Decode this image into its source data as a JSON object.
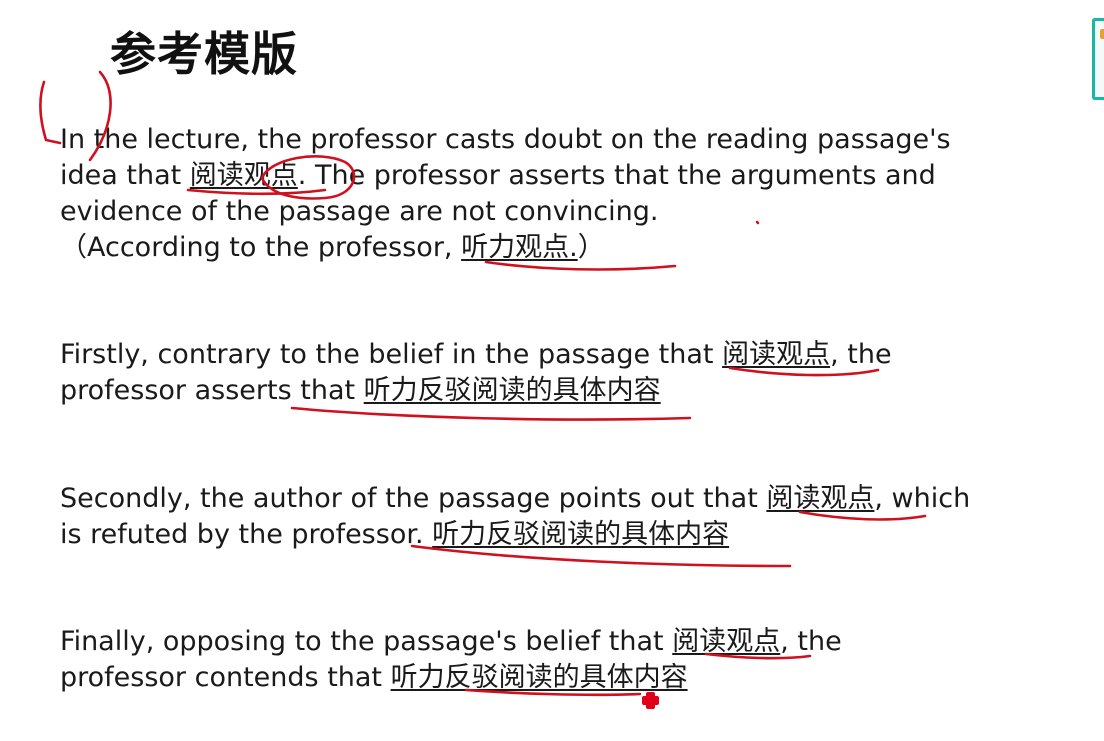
{
  "slide": {
    "title": "参考模版",
    "paragraphs": [
      {
        "lines": [
          [
            {
              "text": "In the lecture, the professor casts doubt on the reading passage's"
            }
          ],
          [
            {
              "text": "idea that "
            },
            {
              "text": "阅读观点",
              "underline": true
            },
            {
              "text": ". The professor asserts that the arguments and"
            }
          ],
          [
            {
              "text": "evidence of the passage are not convincing."
            }
          ],
          [
            {
              "text": "（According to the professor, "
            },
            {
              "text": "听力观点.",
              "underline": true
            },
            {
              "text": "）"
            }
          ]
        ]
      },
      {
        "lines": [
          [
            {
              "text": "Firstly, contrary to the belief in the passage that "
            },
            {
              "text": "阅读观点",
              "underline": true
            },
            {
              "text": ", the"
            }
          ],
          [
            {
              "text": "professor asserts that "
            },
            {
              "text": "听力反驳阅读的具体内容",
              "underline": true
            }
          ]
        ]
      },
      {
        "lines": [
          [
            {
              "text": "Secondly, the author of the passage points out that "
            },
            {
              "text": "阅读观点",
              "underline": true
            },
            {
              "text": ", which"
            }
          ],
          [
            {
              "text": "is refuted by the professor. "
            },
            {
              "text": "听力反驳阅读的具体内容",
              "underline": true
            }
          ]
        ]
      },
      {
        "lines": [
          [
            {
              "text": "Finally, opposing to the passage's belief that "
            },
            {
              "text": "阅读观点",
              "underline": true
            },
            {
              "text": ", the"
            }
          ],
          [
            {
              "text": "professor contends that "
            },
            {
              "text": "听力反驳阅读的具体内容",
              "underline": true
            }
          ]
        ]
      }
    ]
  },
  "annotations": {
    "ink_color": "#d0101e",
    "laser_color": "#e0001a"
  },
  "overlay": {
    "edge_widget_color": "#17b8a6",
    "edge_widget_accent": "#e8a13a"
  }
}
